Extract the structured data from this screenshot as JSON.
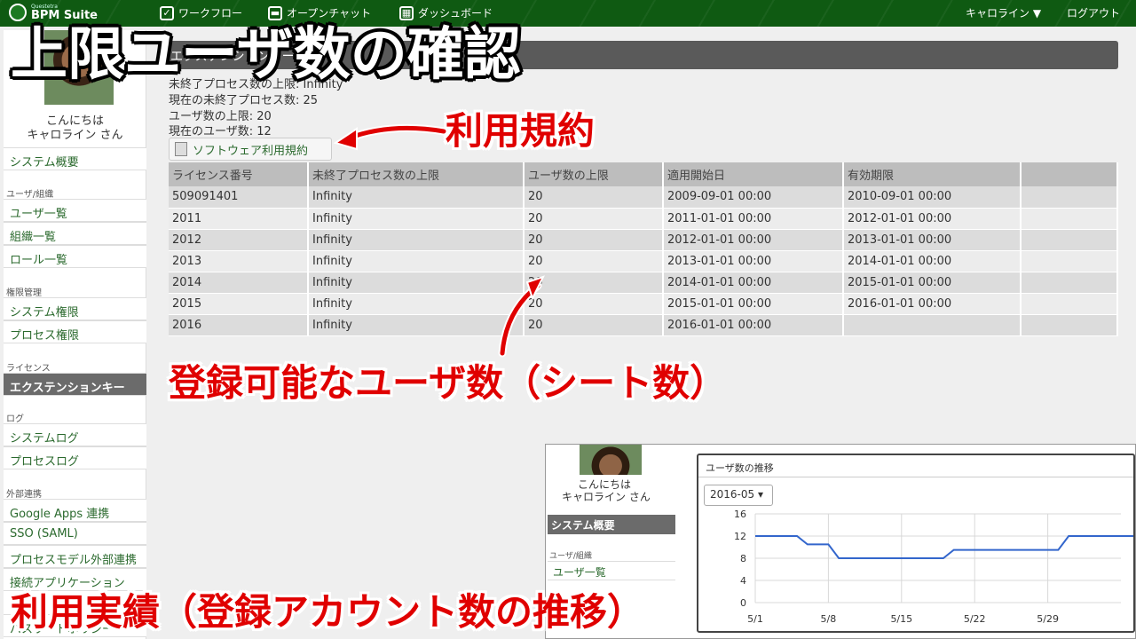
{
  "headline": "上限ユーザ数の確認",
  "topbar": {
    "logo_sub": "Questetra",
    "logo_main": "BPM Suite",
    "workflow": "ワークフロー",
    "open_chat": "オープンチャット",
    "dashboard": "ダッシュボード",
    "user_menu": "キャロライン ▼",
    "logout": "ログアウト"
  },
  "sidebar": {
    "greeting": "こんにちは",
    "user_name": "キャロライン さん",
    "system_overview": "システム概要",
    "cat_users": "ユーザ/組織",
    "user_list": "ユーザ一覧",
    "org_list": "組織一覧",
    "role_list": "ロール一覧",
    "cat_permissions": "権限管理",
    "system_permissions": "システム権限",
    "process_permissions": "プロセス権限",
    "cat_license": "ライセンス",
    "extension_key": "エクステンションキー",
    "cat_log": "ログ",
    "system_log": "システムログ",
    "process_log": "プロセスログ",
    "cat_external": "外部連携",
    "google_apps": "Google Apps 連携",
    "sso": "SSO (SAML)",
    "process_model_external": "プロセスモデル外部連携",
    "connected_apps": "接続アプリケーション",
    "password_policy": "パスワードポリシー"
  },
  "panel": {
    "title": "エクステンションキー",
    "info_max_process": "未終了プロセス数の上限: Infinity",
    "info_current_process": "現在の未終了プロセス数: 25",
    "info_max_users": "ユーザ数の上限: 20",
    "info_current_users": "現在のユーザ数: 12",
    "terms_button": "ソフトウェア利用規約"
  },
  "table": {
    "headers": [
      "ライセンス番号",
      "未終了プロセス数の上限",
      "ユーザ数の上限",
      "適用開始日",
      "有効期限",
      ""
    ],
    "rows": [
      [
        "509091401",
        "Infinity",
        "20",
        "2009-09-01 00:00",
        "2010-09-01 00:00",
        ""
      ],
      [
        "2011",
        "Infinity",
        "20",
        "2011-01-01 00:00",
        "2012-01-01 00:00",
        ""
      ],
      [
        "2012",
        "Infinity",
        "20",
        "2012-01-01 00:00",
        "2013-01-01 00:00",
        ""
      ],
      [
        "2013",
        "Infinity",
        "20",
        "2013-01-01 00:00",
        "2014-01-01 00:00",
        ""
      ],
      [
        "2014",
        "Infinity",
        "20",
        "2014-01-01 00:00",
        "2015-01-01 00:00",
        ""
      ],
      [
        "2015",
        "Infinity",
        "20",
        "2015-01-01 00:00",
        "2016-01-01 00:00",
        ""
      ],
      [
        "2016",
        "Infinity",
        "20",
        "2016-01-01 00:00",
        "",
        ""
      ]
    ]
  },
  "annotations": {
    "terms": "利用規約",
    "registrable_users": "登録可能なユーザ数（シート数）",
    "usage_history": "利用実績（登録アカウント数の推移）",
    "color": "#e00000"
  },
  "inset": {
    "greeting": "こんにちは",
    "user_name": "キャロライン さん",
    "system_overview": "システム概要",
    "cat_users": "ユーザ/組織",
    "user_list": "ユーザ一覧",
    "chart_title": "ユーザ数の推移",
    "month_select": "2016-05 ▾"
  },
  "chart_data": {
    "type": "line",
    "title": "ユーザ数の推移",
    "x": [
      "5/1",
      "5/2",
      "5/3",
      "5/4",
      "5/5",
      "5/6",
      "5/7",
      "5/8",
      "5/9",
      "5/10",
      "5/11",
      "5/12",
      "5/13",
      "5/14",
      "5/15",
      "5/16",
      "5/17",
      "5/18",
      "5/19",
      "5/20",
      "5/21",
      "5/22",
      "5/23",
      "5/24",
      "5/25",
      "5/26",
      "5/27",
      "5/28"
    ],
    "x_ticks": [
      "5/1",
      "5/8",
      "5/15",
      "5/22",
      "5/29"
    ],
    "y_ticks": [
      0,
      4,
      8,
      12,
      16
    ],
    "series": [
      {
        "values": [
          12,
          12,
          12,
          12,
          12,
          10.5,
          10.5,
          10.5,
          8,
          8,
          8,
          8,
          8,
          8,
          8,
          8,
          8,
          8,
          8,
          9.5,
          9.5,
          9.5,
          9.5,
          9.5,
          9.5,
          9.5,
          9.5,
          9.5,
          9.5,
          9.5,
          12,
          12,
          12,
          12,
          12,
          12,
          12,
          12,
          12,
          12
        ]
      }
    ],
    "ylim": [
      0,
      16
    ],
    "line_color": "#3366cc"
  }
}
